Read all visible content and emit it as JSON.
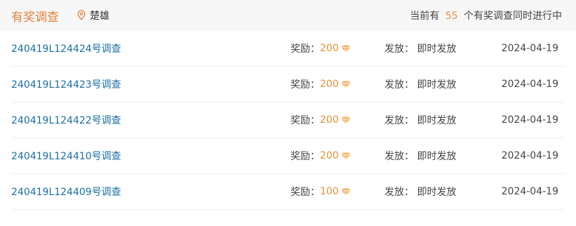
{
  "header": {
    "title": "有奖调查",
    "location": "楚雄",
    "summary_prefix": "当前有",
    "summary_count": "55",
    "summary_suffix": "个有奖调查同时进行中"
  },
  "labels": {
    "reward": "奖励：",
    "release": "发放：",
    "release_value": "即时发放"
  },
  "icons": {
    "location": "location-pin-icon",
    "reward": "diamond-icon"
  },
  "colors": {
    "accent": "#e0823a",
    "link": "#1a6fa3",
    "gem": "#f2b266"
  },
  "surveys": [
    {
      "name": "240419L124424号调查",
      "reward": "200",
      "release": "即时发放",
      "date": "2024-04-19"
    },
    {
      "name": "240419L124423号调查",
      "reward": "200",
      "release": "即时发放",
      "date": "2024-04-19"
    },
    {
      "name": "240419L124422号调查",
      "reward": "200",
      "release": "即时发放",
      "date": "2024-04-19"
    },
    {
      "name": "240419L124410号调查",
      "reward": "200",
      "release": "即时发放",
      "date": "2024-04-19"
    },
    {
      "name": "240419L124409号调查",
      "reward": "100",
      "release": "即时发放",
      "date": "2024-04-19"
    }
  ]
}
